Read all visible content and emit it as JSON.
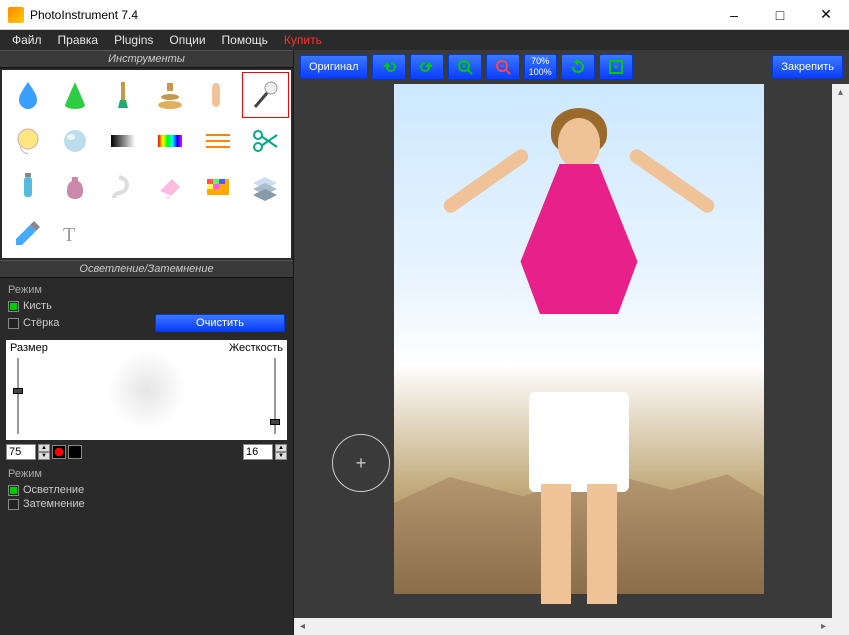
{
  "window": {
    "title": "PhotoInstrument 7.4"
  },
  "menu": {
    "file": "Файл",
    "edit": "Правка",
    "plugins": "Plugins",
    "options": "Опции",
    "help": "Помощь",
    "buy": "Купить"
  },
  "panels": {
    "tools_title": "Инструменты",
    "tool_options_title": "Осветление/Затемнение"
  },
  "tools": [
    "blur-drop",
    "sharpen-cone",
    "brush",
    "clone-stamp",
    "smudge-finger",
    "dodge-burn",
    "clock",
    "sphere",
    "gradient",
    "rainbow",
    "lines",
    "scissors",
    "tube-blue",
    "bottle",
    "spiral-bulb",
    "eraser",
    "mosaic",
    "layers",
    "color-picker",
    "text"
  ],
  "brush": {
    "mode_label": "Режим",
    "mode_brush": "Кисть",
    "mode_eraser": "Стёрка",
    "clear": "Очистить",
    "size_label": "Размер",
    "hardness_label": "Жесткость",
    "size_value": "75",
    "hardness_value": "16"
  },
  "mode2": {
    "label": "Режим",
    "lighten": "Осветление",
    "darken": "Затемнение"
  },
  "toolbar": {
    "original": "Оригинал",
    "zoom1": "70%",
    "zoom2": "100%",
    "pin": "Закрепить"
  }
}
